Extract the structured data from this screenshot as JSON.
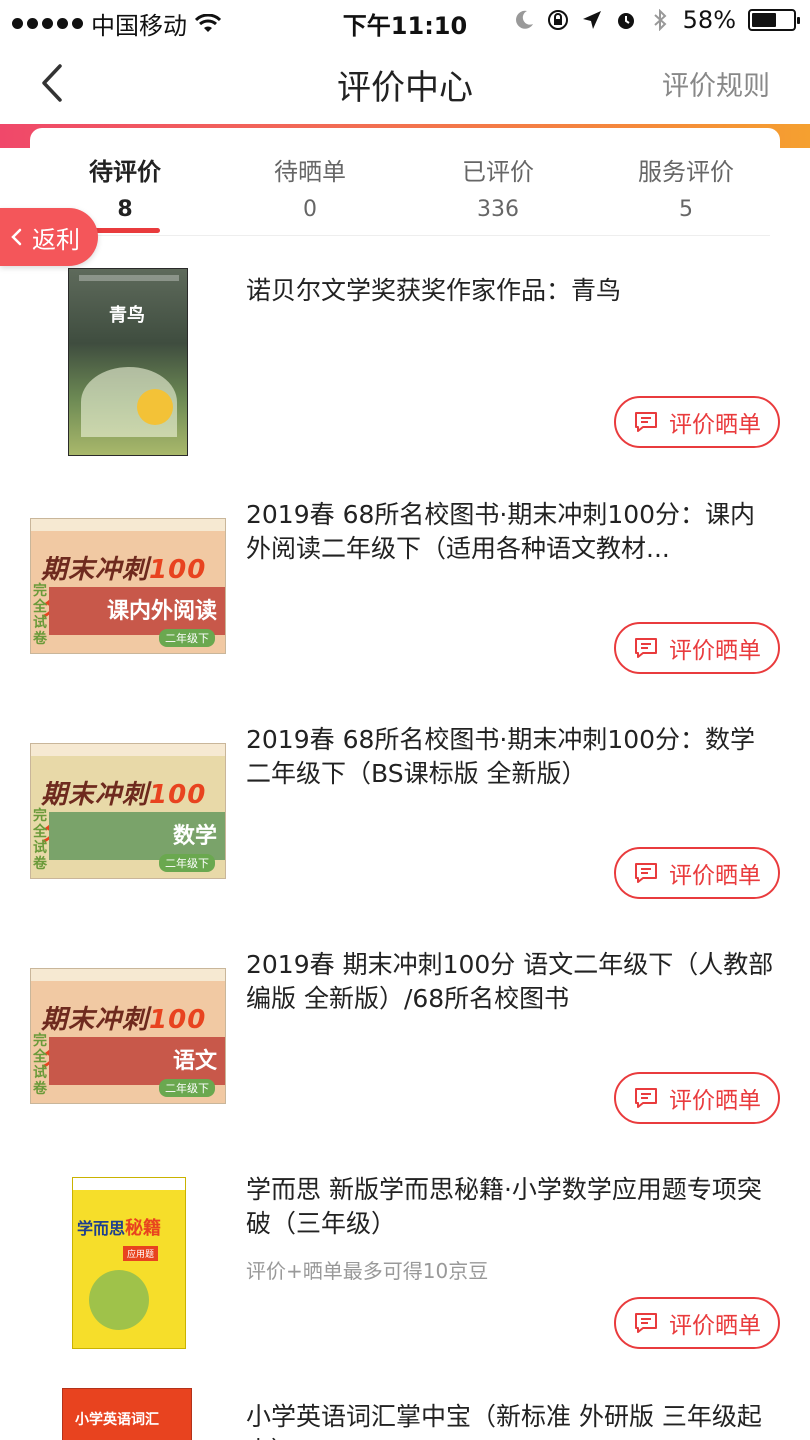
{
  "status_bar": {
    "carrier": "中国移动",
    "time": "下午11:10",
    "battery_text": "58%",
    "battery_level": 0.58
  },
  "nav": {
    "title": "评价中心",
    "rules_link": "评价规则"
  },
  "tabs": [
    {
      "label": "待评价",
      "count": "8",
      "active": true
    },
    {
      "label": "待晒单",
      "count": "0",
      "active": false
    },
    {
      "label": "已评价",
      "count": "336",
      "active": false
    },
    {
      "label": "服务评价",
      "count": "5",
      "active": false
    }
  ],
  "rebate": {
    "label": "返利"
  },
  "review_button_label": "评价晒单",
  "products": [
    {
      "title": "诺贝尔文学奖获奖作家作品：青鸟",
      "promo": "",
      "cover": {
        "title": "青鸟"
      }
    },
    {
      "title": "2019春 68所名校图书·期末冲刺100分：课内外阅读二年级下（适用各种语文教材...",
      "promo": "",
      "cover": {
        "series": "期末冲刺",
        "num": "100分",
        "subject": "课内外阅读",
        "side": "完全试卷",
        "grade": "二年级下",
        "band_color": "#c8584a",
        "bg_color": "#f1c9a3"
      }
    },
    {
      "title": "2019春 68所名校图书·期末冲刺100分：数学二年级下（BS课标版 全新版）",
      "promo": "",
      "cover": {
        "series": "期末冲刺",
        "num": "100分",
        "subject": "数学",
        "side": "完全试卷",
        "grade": "二年级下",
        "band_color": "#7aa36a",
        "bg_color": "#e8d9a8"
      }
    },
    {
      "title": "2019春 期末冲刺100分 语文二年级下（人教部编版 全新版）/68所名校图书",
      "promo": "",
      "cover": {
        "series": "期末冲刺",
        "num": "100分",
        "subject": "语文",
        "side": "完全试卷",
        "grade": "二年级下",
        "band_color": "#c8584a",
        "bg_color": "#f1c9a3"
      }
    },
    {
      "title": "学而思 新版学而思秘籍·小学数学应用题专项突破（三年级）",
      "promo": "评价+晒单最多可得10京豆",
      "cover": {
        "title": "学而思",
        "title2": "秘籍",
        "tag": "应用题"
      }
    },
    {
      "title": "小学英语词汇掌中宝（新标准 外研版 三年级起点）",
      "promo": "",
      "cover": {
        "title": "小学英语词汇"
      }
    }
  ]
}
